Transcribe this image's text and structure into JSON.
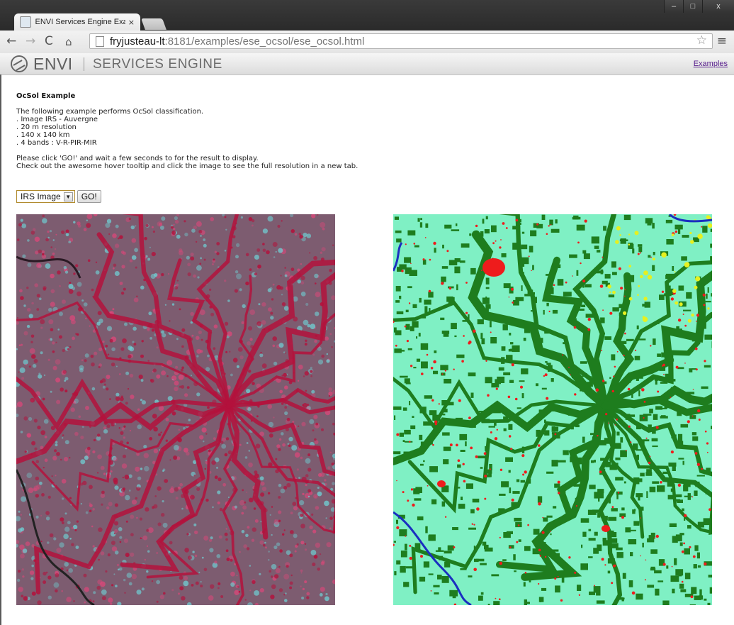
{
  "browser": {
    "tab_title": "ENVI Services Engine Exam",
    "tab_close": "×",
    "url_host": "fryjusteau-lt",
    "url_rest": ":8181/examples/ese_ocsol/ese_ocsol.html",
    "window_buttons": {
      "minimize": "‒",
      "maximize": "□",
      "close": "x"
    }
  },
  "header": {
    "brand": "ENVI",
    "subtitle": "SERVICES ENGINE",
    "examples_link": "Examples"
  },
  "main": {
    "title": "OcSol Example",
    "intro": "The following example performs OcSol classification.",
    "details": [
      ". Image IRS - Auvergne",
      ". 20 m resolution",
      ". 140 x 140 km",
      ". 4 bands : V-R-PIR-MIR"
    ],
    "instructions": [
      "Please click 'GO!' and wait a few seconds to for the result to display.",
      "Check out the awesome hover tooltip and click the image to see the full resolution in a new tab."
    ]
  },
  "controls": {
    "select_value": "IRS Image",
    "go_label": "GO!"
  },
  "colors": {
    "irs_base": "#7d5c70",
    "irs_red": "#b3123c",
    "irs_pink": "#e0467a",
    "irs_cyan": "#6fd4d8",
    "class_base": "#7ff0c4",
    "class_forest": "#1e7d1e",
    "class_urban": "#ee1c1c",
    "class_water": "#1a2fc0",
    "class_yellow": "#e6f020",
    "link": "#551a8b"
  }
}
